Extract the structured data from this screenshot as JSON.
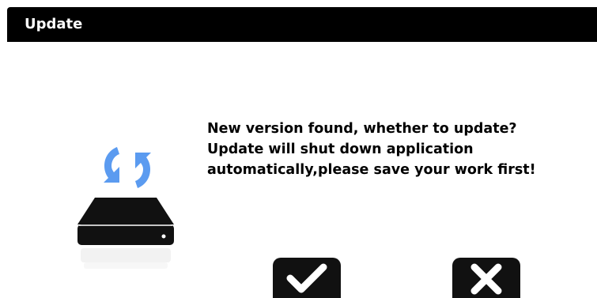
{
  "window": {
    "title": "Update"
  },
  "message": {
    "lines": [
      "New version found, whether to update?",
      "Update will shut down application",
      "automatically,please save your work first!"
    ]
  },
  "icons": {
    "illustration": "disk-update-icon",
    "confirm": "checkmark-icon",
    "cancel": "close-icon"
  },
  "colors": {
    "titlebar_bg": "#000000",
    "titlebar_text": "#ffffff",
    "refresh_arrows": "#5b9bf0",
    "disk_body": "#111111",
    "button_bg": "#111111",
    "button_glyph": "#ffffff"
  }
}
